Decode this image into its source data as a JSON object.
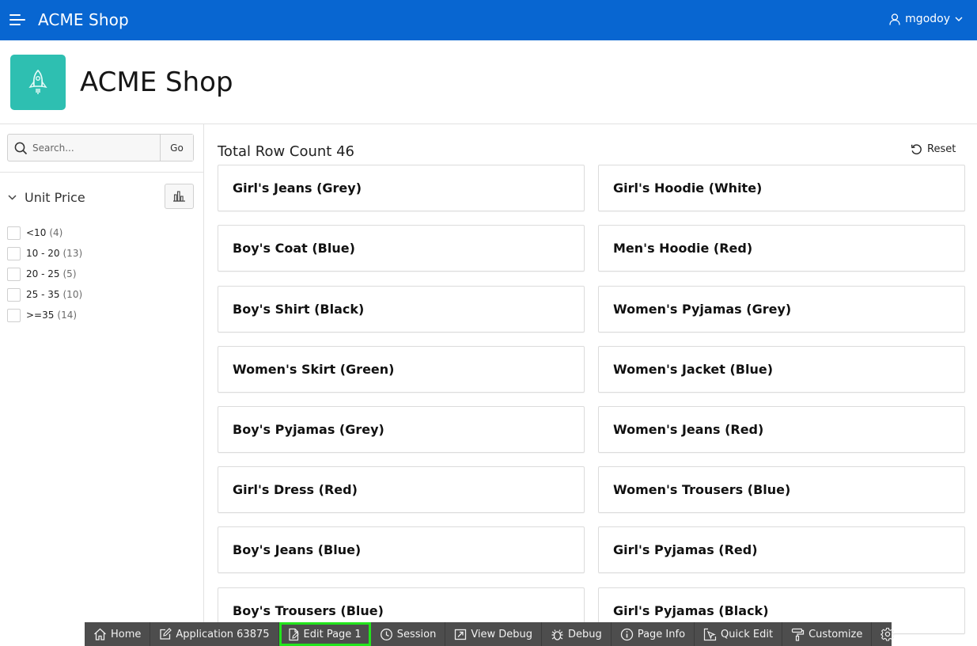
{
  "header": {
    "app_title": "ACME Shop",
    "user": "mgodoy",
    "brand_color": "#0866d1"
  },
  "hero": {
    "title": "ACME Shop",
    "icon": "rocket-icon",
    "icon_color": "#2ebfb1"
  },
  "sidebar": {
    "search": {
      "placeholder": "Search...",
      "value": ""
    },
    "go_label": "Go",
    "facet": {
      "title": "Unit Price",
      "items": [
        {
          "label": "<10",
          "count": "(4)"
        },
        {
          "label": "10 - 20",
          "count": "(13)"
        },
        {
          "label": "20 - 25",
          "count": "(5)"
        },
        {
          "label": "25 - 35",
          "count": "(10)"
        },
        {
          "label": ">=35",
          "count": "(14)"
        }
      ]
    }
  },
  "main": {
    "row_count": "Total Row Count 46",
    "reset_label": "Reset",
    "cards": [
      "Girl's Jeans (Grey)",
      "Girl's Hoodie (White)",
      "Boy's Coat (Blue)",
      "Men's Hoodie (Red)",
      "Boy's Shirt (Black)",
      "Women's Pyjamas (Grey)",
      "Women's Skirt (Green)",
      "Women's Jacket (Blue)",
      "Boy's Pyjamas (Grey)",
      "Women's Jeans (Red)",
      "Girl's Dress (Red)",
      "Women's Trousers (Blue)",
      "Boy's Jeans (Blue)",
      "Girl's Pyjamas (Red)",
      "Boy's Trousers (Blue)",
      "Girl's Pyjamas (Black)"
    ]
  },
  "devbar": {
    "items": [
      {
        "label": "Home",
        "icon": "home-icon"
      },
      {
        "label": "Application 63875",
        "icon": "edit-icon"
      },
      {
        "label": "Edit Page 1",
        "icon": "edit-page-icon",
        "highlighted": true
      },
      {
        "label": "Session",
        "icon": "session-icon"
      },
      {
        "label": "View Debug",
        "icon": "view-debug-icon"
      },
      {
        "label": "Debug",
        "icon": "bug-icon"
      },
      {
        "label": "Page Info",
        "icon": "info-icon"
      },
      {
        "label": "Quick Edit",
        "icon": "quick-edit-icon"
      },
      {
        "label": "Customize",
        "icon": "paint-roller-icon"
      },
      {
        "label": "",
        "icon": "gear-icon"
      }
    ],
    "highlight_color": "#23e41c"
  }
}
